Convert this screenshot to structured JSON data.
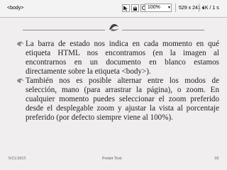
{
  "status_bar": {
    "tag_label": "<body>",
    "zoom_value": "100%",
    "dimensions": "529 x 241",
    "size_rate": "1K / 1 s",
    "tools": [
      "pointer-icon",
      "hand-icon",
      "zoom-icon"
    ]
  },
  "content": {
    "bullets": [
      "La barra de estado nos indica en cada momento en qué etiqueta HTML nos encontramos (en la imagen al encontrarnos en un documento en blanco estamos directamente sobre la etiqueta <body>).",
      "También nos es posible alternar entre los modos de selección, mano (para arrastrar la página), o zoom. En cualquier momento puedes seleccionar el zoom preferido desde el desplegable zoom y ajustar la vista al porcentaje preferido (por defecto siempre viene al 100%)."
    ]
  },
  "footer": {
    "date": "9/21/2015",
    "text": "Footer Text",
    "page": "18"
  }
}
